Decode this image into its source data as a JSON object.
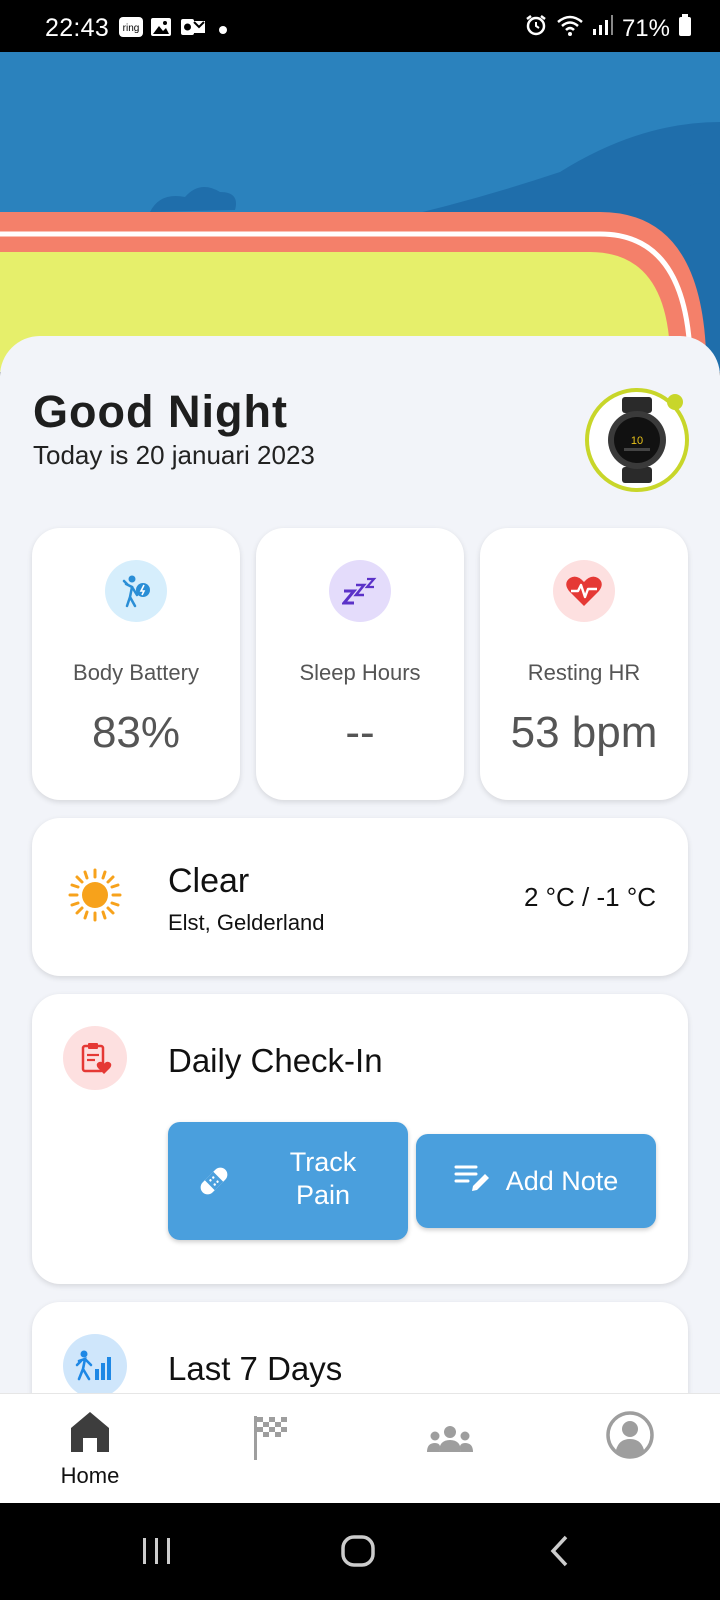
{
  "status_bar": {
    "time": "22:43",
    "notif_ring": "ring",
    "battery": "71%"
  },
  "header": {
    "greeting": "Good Night",
    "date_line": "Today is 20 januari 2023"
  },
  "metrics": [
    {
      "label": "Body Battery",
      "value": "83%",
      "icon": "body-battery-icon",
      "icon_bg": "#d6eefc",
      "icon_color": "#2a8ed6"
    },
    {
      "label": "Sleep Hours",
      "value": "--",
      "icon": "sleep-icon",
      "icon_bg": "#e4dcfb",
      "icon_color": "#5b32c8"
    },
    {
      "label": "Resting HR",
      "value": "53 bpm",
      "icon": "heart-rate-icon",
      "icon_bg": "#fde0e0",
      "icon_color": "#e53935"
    }
  ],
  "weather": {
    "condition": "Clear",
    "location": "Elst, Gelderland",
    "temperature": "2 °C / -1 °C",
    "icon": "sun-icon",
    "icon_color": "#f7a21b"
  },
  "checkin": {
    "title": "Daily Check-In",
    "track_pain_label": "Track Pain",
    "add_note_label": "Add Note",
    "button_color": "#4a9fdd"
  },
  "last7": {
    "title": "Last 7 Days"
  },
  "bottom_nav": {
    "home_label": "Home",
    "items": [
      "home-icon",
      "challenges-flag-icon",
      "community-icon",
      "profile-icon"
    ]
  },
  "colors": {
    "sky": "#2b82bd",
    "track": "#f4806a",
    "field": "#e6ef6b",
    "accent_ring": "#c8d62a"
  }
}
